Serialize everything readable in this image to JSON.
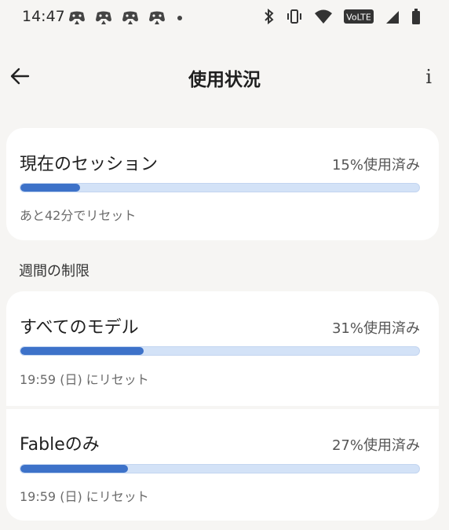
{
  "status_bar": {
    "time": "14:47",
    "notification_icons": [
      "game-controller-icon",
      "game-controller-icon",
      "game-controller-icon",
      "game-controller-icon"
    ],
    "system_icons": [
      "bluetooth-icon",
      "vibrate-icon",
      "wifi-icon",
      "volte-icon",
      "signal-icon",
      "battery-icon"
    ],
    "volte_label": "VoLTE"
  },
  "header": {
    "title": "使用状況",
    "back_icon": "arrow-left-icon",
    "info_label": "i"
  },
  "session": {
    "label": "現在のセッション",
    "usage": "15%使用済み",
    "percent": 15,
    "reset": "あと42分でリセット"
  },
  "weekly": {
    "section_title": "週間の制限",
    "items": [
      {
        "label": "すべてのモデル",
        "usage": "31%使用済み",
        "percent": 31,
        "reset": "19:59 (日) にリセット"
      },
      {
        "label": "Fableのみ",
        "usage": "27%使用済み",
        "percent": 27,
        "reset": "19:59 (日) にリセット"
      }
    ]
  },
  "colors": {
    "background": "#f6f5f3",
    "card": "#ffffff",
    "bar_track": "#d3e2f7",
    "bar_fill": "#3d72c9"
  }
}
